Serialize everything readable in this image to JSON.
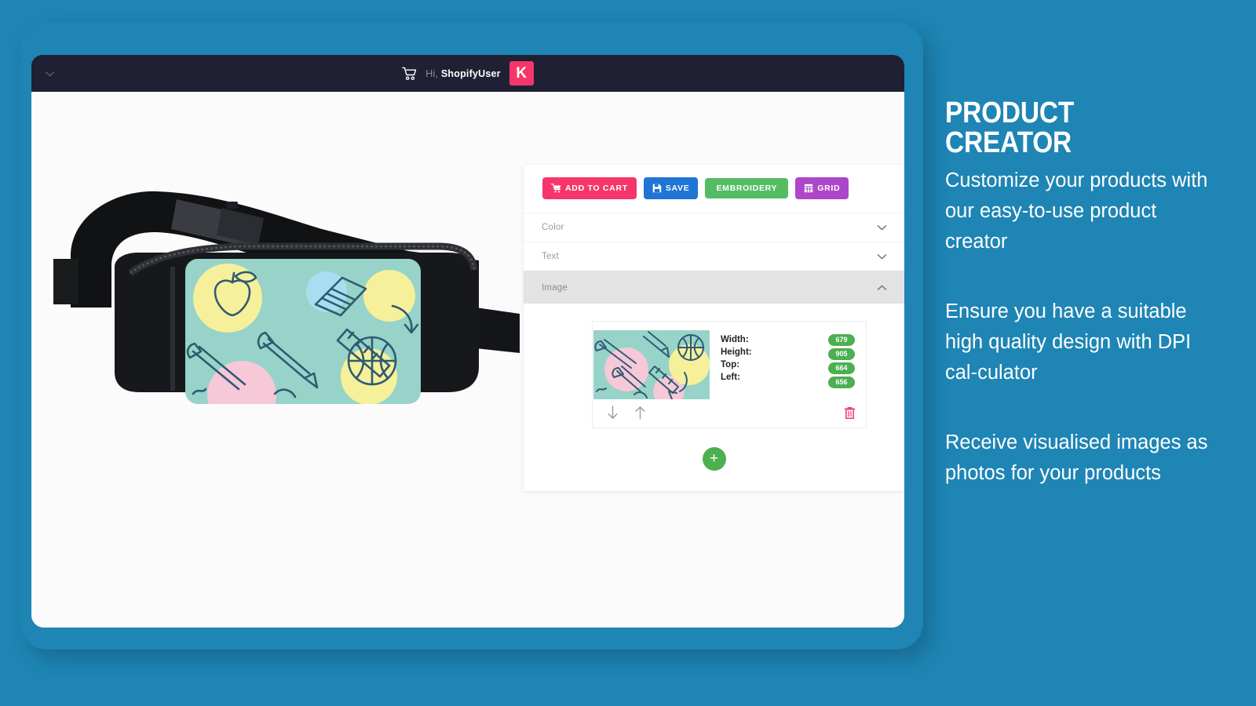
{
  "theme": {
    "page_background": "#1e85b5",
    "frame_border": "#1e85b5",
    "topbar_background": "#1f2034",
    "accent_pink": "#f6366b",
    "accent_blue": "#1f74d6",
    "accent_green": "#54bd63",
    "accent_purple": "#ad46c8",
    "badge_green": "#4caf50"
  },
  "topbar": {
    "greeting_prefix": "Hi,",
    "username": "ShopifyUser",
    "avatar_initial": "K",
    "cart_icon": "shopping-cart-icon",
    "menu_icon": "chevron-down-icon"
  },
  "editor": {
    "actions": [
      {
        "label": "ADD TO CART",
        "icon": "shopping-cart-icon",
        "color": "#f6366b"
      },
      {
        "label": "SAVE",
        "icon": "floppy-disk-icon",
        "color": "#1f74d6"
      },
      {
        "label": "EMBROIDERY",
        "icon": "none",
        "color": "#54bd63"
      },
      {
        "label": "GRID",
        "icon": "grid-icon",
        "color": "#ad46c8"
      }
    ],
    "sections": [
      {
        "label": "Color",
        "expanded": false,
        "chevron": "chevron-down-icon"
      },
      {
        "label": "Text",
        "expanded": false,
        "chevron": "chevron-down-icon"
      },
      {
        "label": "Image",
        "expanded": true,
        "chevron": "chevron-up-icon"
      }
    ],
    "image_item": {
      "thumbnail_alt": "school-supplies-pattern-thumbnail",
      "properties": [
        {
          "label": "Width:",
          "value": "679"
        },
        {
          "label": "Height:",
          "value": "905"
        },
        {
          "label": "Top:",
          "value": "664"
        },
        {
          "label": "Left:",
          "value": "656"
        }
      ],
      "move_down_icon": "arrow-down-icon",
      "move_up_icon": "arrow-up-icon",
      "delete_icon": "trash-icon"
    },
    "add_button_label": "+"
  },
  "product": {
    "name": "fanny-pack-mockup",
    "design_alt": "school-supplies-pattern"
  },
  "marketing": {
    "title": "PRODUCT CREATOR",
    "paragraphs": [
      "Customize your products with our easy-to-use product creator",
      "Ensure you have a suitable high quality design with DPI cal-culator",
      "Receive visualised images as photos for your products"
    ]
  }
}
